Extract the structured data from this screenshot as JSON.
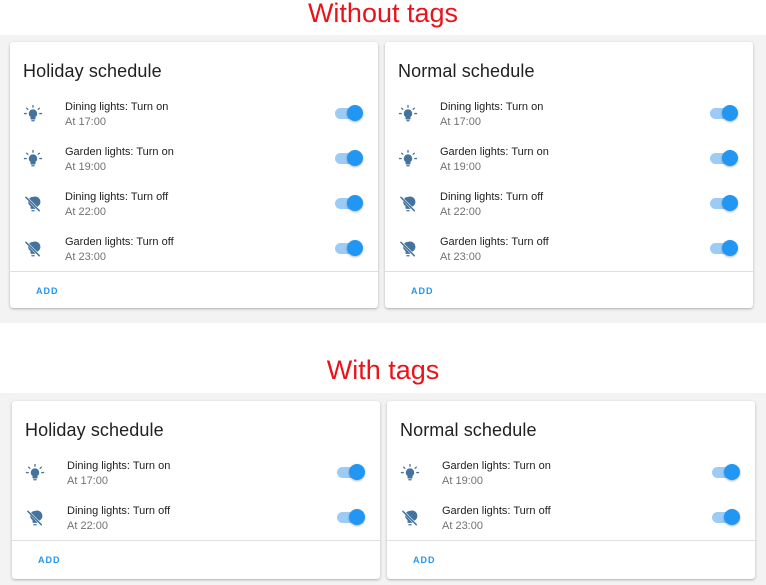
{
  "sections": {
    "without": {
      "title": "Without tags",
      "cards": [
        {
          "title": "Holiday schedule",
          "add_label": "ADD",
          "rows": [
            {
              "name": "Dining lights: Turn on",
              "time": "At 17:00",
              "icon": "lightbulb-on-icon",
              "enabled": true
            },
            {
              "name": "Garden lights: Turn on",
              "time": "At 19:00",
              "icon": "lightbulb-on-icon",
              "enabled": true
            },
            {
              "name": "Dining lights: Turn off",
              "time": "At 22:00",
              "icon": "lightbulb-off-icon",
              "enabled": true
            },
            {
              "name": "Garden lights: Turn off",
              "time": "At 23:00",
              "icon": "lightbulb-off-icon",
              "enabled": true
            }
          ]
        },
        {
          "title": "Normal schedule",
          "add_label": "ADD",
          "rows": [
            {
              "name": "Dining lights: Turn on",
              "time": "At 17:00",
              "icon": "lightbulb-on-icon",
              "enabled": true
            },
            {
              "name": "Garden lights: Turn on",
              "time": "At 19:00",
              "icon": "lightbulb-on-icon",
              "enabled": true
            },
            {
              "name": "Dining lights: Turn off",
              "time": "At 22:00",
              "icon": "lightbulb-off-icon",
              "enabled": true
            },
            {
              "name": "Garden lights: Turn off",
              "time": "At 23:00",
              "icon": "lightbulb-off-icon",
              "enabled": true
            }
          ]
        }
      ]
    },
    "with": {
      "title": "With tags",
      "cards": [
        {
          "title": "Holiday schedule",
          "add_label": "ADD",
          "rows": [
            {
              "name": "Dining lights: Turn on",
              "time": "At 17:00",
              "icon": "lightbulb-on-icon",
              "enabled": true
            },
            {
              "name": "Dining lights: Turn off",
              "time": "At 22:00",
              "icon": "lightbulb-off-icon",
              "enabled": true
            }
          ]
        },
        {
          "title": "Normal schedule",
          "add_label": "ADD",
          "rows": [
            {
              "name": "Garden lights: Turn on",
              "time": "At 19:00",
              "icon": "lightbulb-on-icon",
              "enabled": true
            },
            {
              "name": "Garden lights: Turn off",
              "time": "At 23:00",
              "icon": "lightbulb-off-icon",
              "enabled": true
            }
          ]
        }
      ]
    }
  },
  "colors": {
    "section_title": "#e8141b",
    "accent": "#2196f3",
    "icon": "#44739e"
  }
}
